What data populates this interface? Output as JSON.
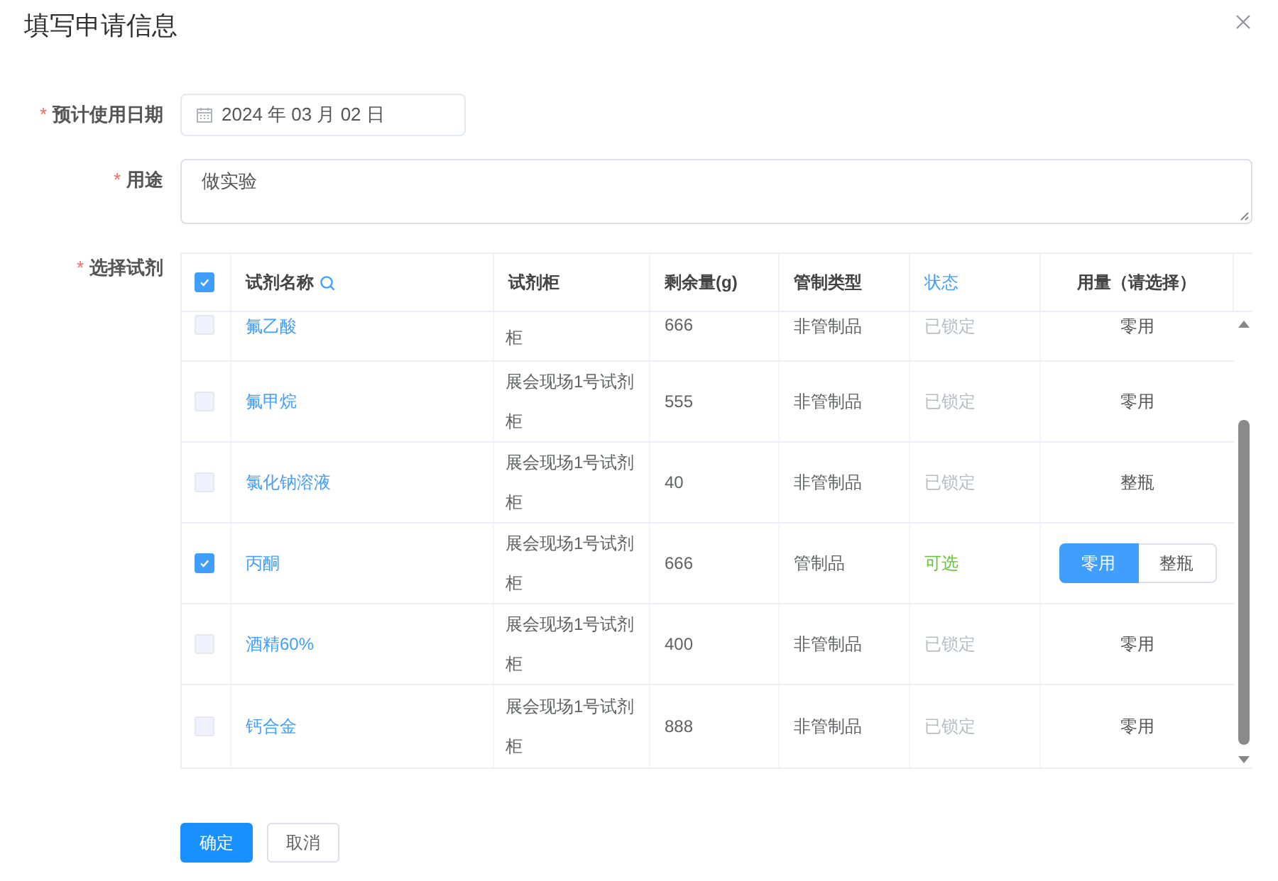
{
  "dialog": {
    "title": "填写申请信息"
  },
  "form": {
    "fields": [
      {
        "label": "预计使用日期",
        "required_mark": "*",
        "kind": "date",
        "value": "2024 年 03 月 02 日"
      },
      {
        "label": "用途",
        "required_mark": "*",
        "kind": "textarea",
        "value": "做实验"
      },
      {
        "label": "选择试剂",
        "required_mark": "*",
        "kind": "table"
      }
    ]
  },
  "table": {
    "header_checkbox": {
      "checked": true
    },
    "columns": [
      {
        "label": "试剂名称",
        "searchable": true,
        "highlighted": false
      },
      {
        "label": "试剂柜",
        "searchable": false,
        "highlighted": false
      },
      {
        "label": "剩余量(g)",
        "searchable": false,
        "highlighted": false
      },
      {
        "label": "管制类型",
        "searchable": false,
        "highlighted": false
      },
      {
        "label": "状态",
        "searchable": false,
        "highlighted": true
      },
      {
        "label": "用量（请选择）",
        "searchable": false,
        "highlighted": false
      }
    ],
    "rows": [
      {
        "checked": false,
        "disabled": true,
        "name": "氟乙酸",
        "cabinet": "柜",
        "remaining": "666",
        "control_type": "非管制品",
        "status": {
          "kind": "locked",
          "text": "已锁定"
        },
        "usage": {
          "kind": "text",
          "text": "零用"
        }
      },
      {
        "checked": false,
        "disabled": true,
        "name": "氟甲烷",
        "cabinet": "展会现场1号试剂柜",
        "remaining": "555",
        "control_type": "非管制品",
        "status": {
          "kind": "locked",
          "text": "已锁定"
        },
        "usage": {
          "kind": "text",
          "text": "零用"
        }
      },
      {
        "checked": false,
        "disabled": true,
        "name": "氯化钠溶液",
        "cabinet": "展会现场1号试剂柜",
        "remaining": "40",
        "control_type": "非管制品",
        "status": {
          "kind": "locked",
          "text": "已锁定"
        },
        "usage": {
          "kind": "text",
          "text": "整瓶"
        }
      },
      {
        "checked": true,
        "disabled": false,
        "name": "丙酮",
        "cabinet": "展会现场1号试剂柜",
        "remaining": "666",
        "control_type": "管制品",
        "status": {
          "kind": "available",
          "text": "可选"
        },
        "usage": {
          "kind": "picker",
          "options": [
            {
              "label": "零用",
              "selected": true
            },
            {
              "label": "整瓶",
              "selected": false
            }
          ]
        }
      },
      {
        "checked": false,
        "disabled": true,
        "name": "酒精60%",
        "cabinet": "展会现场1号试剂柜",
        "remaining": "400",
        "control_type": "非管制品",
        "status": {
          "kind": "locked",
          "text": "已锁定"
        },
        "usage": {
          "kind": "text",
          "text": "零用"
        }
      },
      {
        "checked": false,
        "disabled": true,
        "name": "钙合金",
        "cabinet": "展会现场1号试剂柜",
        "remaining": "888",
        "control_type": "非管制品",
        "status": {
          "kind": "locked",
          "text": "已锁定"
        },
        "usage": {
          "kind": "text",
          "text": "零用"
        }
      }
    ]
  },
  "buttons": [
    {
      "label": "确定",
      "kind": "primary"
    },
    {
      "label": "取消",
      "kind": "default"
    }
  ]
}
